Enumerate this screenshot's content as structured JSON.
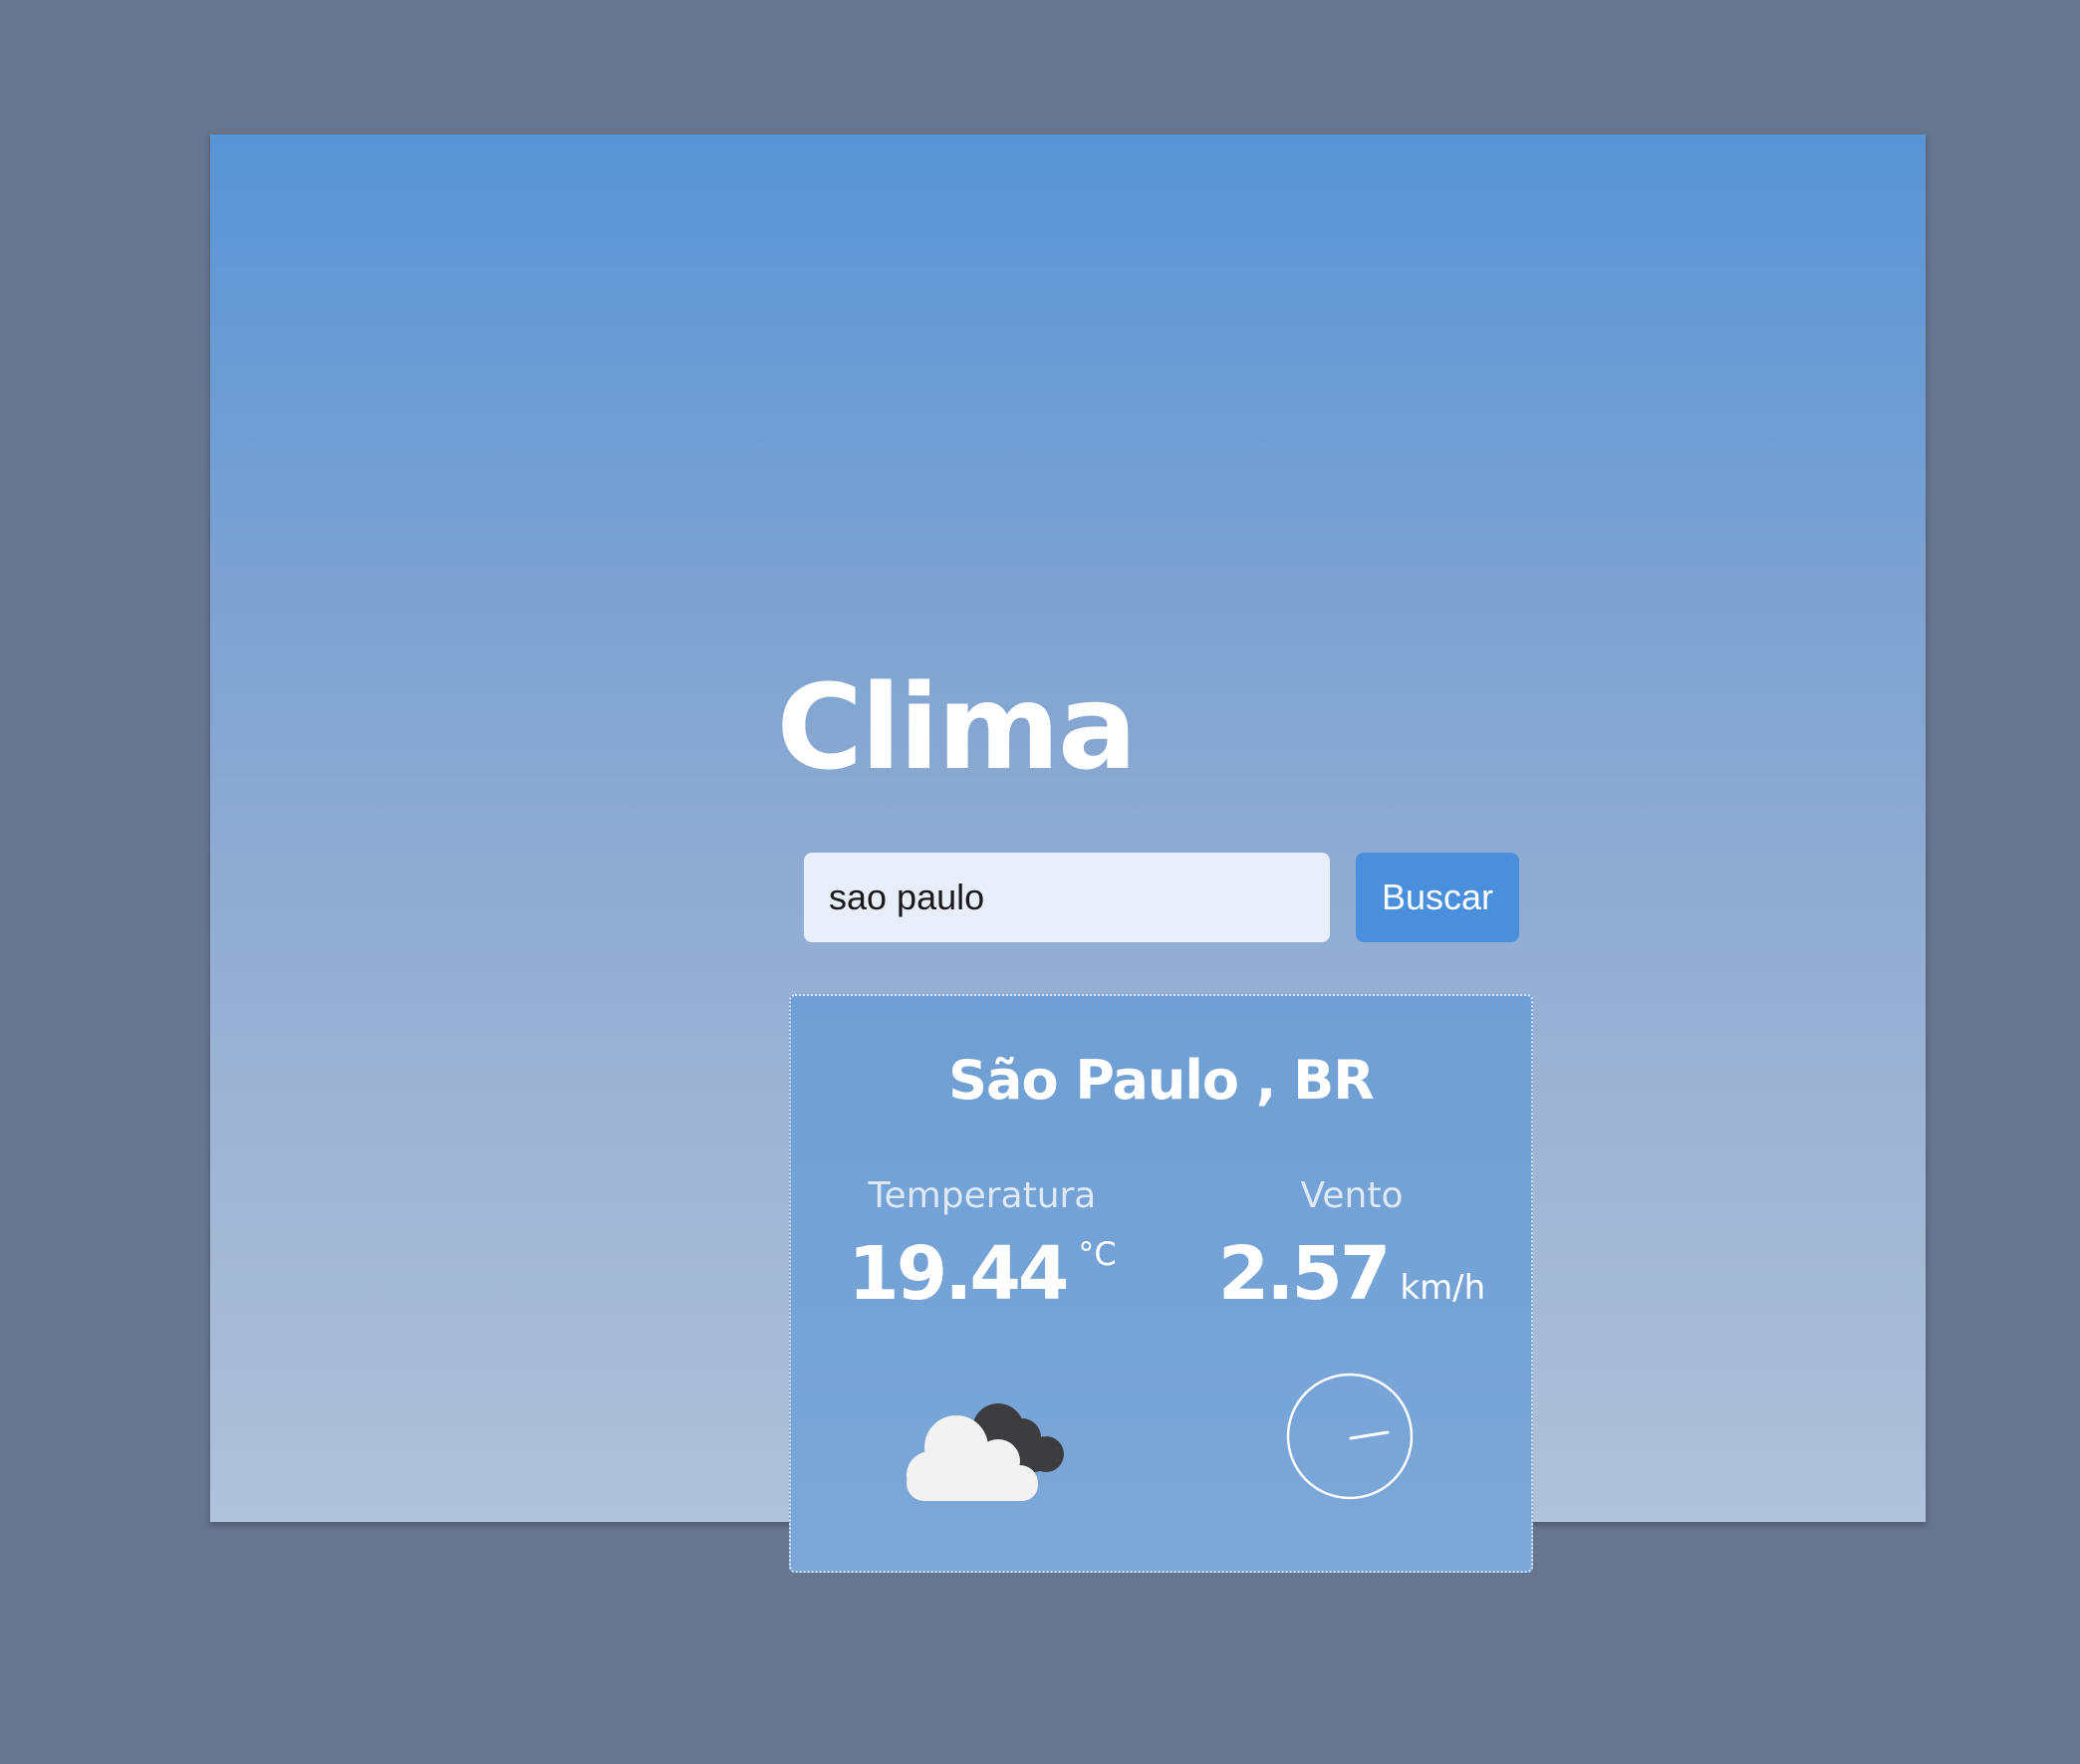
{
  "app": {
    "title": "Clima"
  },
  "search": {
    "value": "sao paulo",
    "button_label": "Buscar"
  },
  "weather": {
    "location": "São Paulo , BR",
    "temperature": {
      "label": "Temperatura",
      "value": "19.44",
      "unit": "°C"
    },
    "wind": {
      "label": "Vento",
      "value": "2.57",
      "unit": "km/h"
    },
    "condition_icon": "cloudy-icon",
    "wind_direction_icon": "wind-direction-dial-icon"
  },
  "colors": {
    "backdrop": "#68758f",
    "gradient_top": "#5895d6",
    "gradient_bottom": "#afc2da",
    "button": "#4a8fdb",
    "input_background": "#e8effb",
    "text": "#ffffff"
  }
}
